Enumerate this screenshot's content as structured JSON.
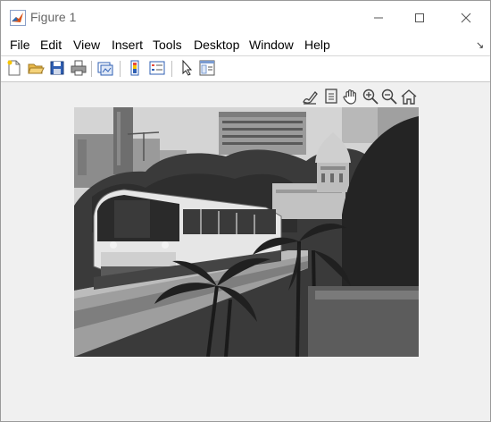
{
  "window": {
    "title": "Figure 1"
  },
  "menu": [
    "File",
    "Edit",
    "View",
    "Insert",
    "Tools",
    "Desktop",
    "Window",
    "Help"
  ],
  "toolbar_icons": [
    "new-figure-icon",
    "open-file-icon",
    "save-icon",
    "print-icon",
    "link-plot-icon",
    "insert-colorbar-icon",
    "insert-legend-icon",
    "edit-plot-arrow-icon",
    "property-inspector-icon"
  ],
  "axes_toolbar_icons": [
    "brush-icon",
    "data-tips-icon",
    "pan-hand-icon",
    "zoom-in-icon",
    "zoom-out-icon",
    "home-restore-icon"
  ],
  "image": {
    "description_kind": "grayscale photo",
    "colors": {
      "sky": "#d4d4d4",
      "train": "#e6e6e6"
    }
  }
}
